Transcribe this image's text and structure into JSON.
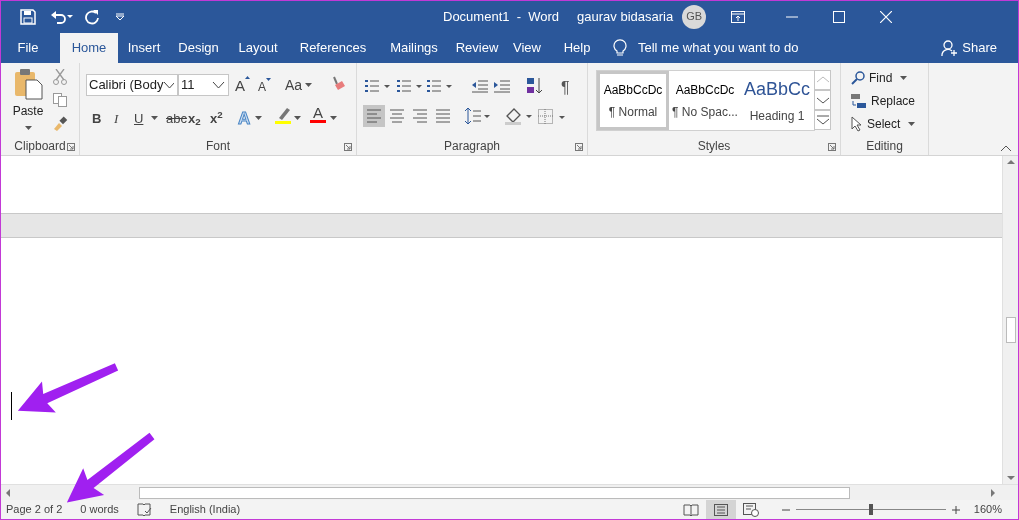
{
  "window": {
    "title": "Document1  -  Word",
    "user": "gaurav bidasaria",
    "avatar": "GB"
  },
  "tabs": [
    {
      "label": "File",
      "selected": false
    },
    {
      "label": "Home",
      "selected": true
    },
    {
      "label": "Insert",
      "selected": false
    },
    {
      "label": "Design",
      "selected": false
    },
    {
      "label": "Layout",
      "selected": false
    },
    {
      "label": "References",
      "selected": false
    },
    {
      "label": "Mailings",
      "selected": false
    },
    {
      "label": "Review",
      "selected": false
    },
    {
      "label": "View",
      "selected": false
    },
    {
      "label": "Help",
      "selected": false
    }
  ],
  "tell_me": {
    "placeholder": "Tell me what you want to do"
  },
  "share": "Share",
  "ribbon": {
    "clipboard": {
      "paste": "Paste",
      "label": "Clipboard"
    },
    "font": {
      "font_name": "Calibri (Body",
      "font_size": "11",
      "grow_font": "A",
      "shrink_font": "A",
      "text_effects": "A",
      "font_color": "A",
      "change_case": "Aa",
      "format_buttons": [
        {
          "label": "B",
          "kind": "bold"
        },
        {
          "label": "I",
          "kind": "italic"
        },
        {
          "label": "U",
          "kind": "underline"
        },
        {
          "label": "abc",
          "kind": "strike"
        },
        {
          "label": "x$_{2}$",
          "kind": "plain"
        },
        {
          "label": "x$^{2}$",
          "kind": "plain"
        }
      ],
      "label": "Font"
    },
    "paragraph": {
      "alignments": [
        {
          "selected": true
        },
        {
          "selected": false
        },
        {
          "selected": false
        },
        {
          "selected": false
        }
      ],
      "show_marks": "¶",
      "label": "Paragraph"
    },
    "styles": {
      "items": [
        {
          "preview": "AaBbCcDc",
          "name": "¶ Normal",
          "kind": "body",
          "selected": true
        },
        {
          "preview": "AaBbCcDc",
          "name": "¶ No Spac...",
          "kind": "body",
          "selected": false
        },
        {
          "preview": "AaBbCc",
          "name": "Heading 1",
          "kind": "heading",
          "selected": false
        }
      ],
      "label": "Styles"
    },
    "editing": {
      "items": [
        "Find",
        "Replace",
        "Select"
      ],
      "label": "Editing"
    }
  },
  "annotation_arrows": [
    {
      "kind": "arrow"
    },
    {
      "kind": "arrow"
    }
  ],
  "status_bar": {
    "page": "Page 2 of 2",
    "words": "0 words",
    "language": "English (India)",
    "views": [
      {
        "kind": "read",
        "selected": false
      },
      {
        "kind": "print",
        "selected": true
      },
      {
        "kind": "web",
        "selected": false
      }
    ],
    "zoom": {
      "level": 0.5,
      "reading": "160%"
    }
  }
}
